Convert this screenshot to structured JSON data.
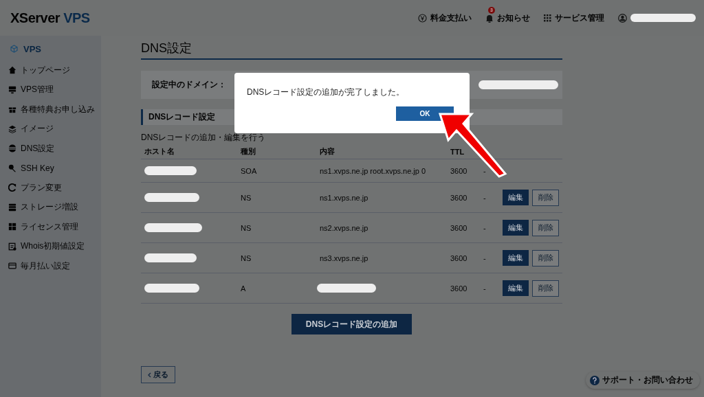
{
  "header": {
    "logo": {
      "brand": "XServer",
      "product": "VPS"
    },
    "nav": [
      {
        "kind": "payment",
        "label": "料金支払い"
      },
      {
        "kind": "notice",
        "label": "お知らせ",
        "badge": "3"
      },
      {
        "kind": "services",
        "label": "サービス管理"
      },
      {
        "kind": "account"
      }
    ]
  },
  "sidebar": {
    "section": "VPS",
    "items": [
      {
        "label": "トップページ"
      },
      {
        "label": "VPS管理"
      },
      {
        "label": "各種特典お申し込み"
      },
      {
        "label": "イメージ"
      },
      {
        "label": "DNS設定"
      },
      {
        "label": "SSH Key"
      },
      {
        "label": "プラン変更"
      },
      {
        "label": "ストレージ増設"
      },
      {
        "label": "ライセンス管理"
      },
      {
        "label": "Whois初期値設定"
      },
      {
        "label": "毎月払い設定"
      }
    ]
  },
  "page": {
    "title": "DNS設定",
    "domain_label": "設定中のドメイン：",
    "section_title": "DNSレコード設定",
    "description": "DNSレコードの追加・編集を行う",
    "columns": [
      "ホスト名",
      "種別",
      "内容",
      "TTL"
    ],
    "rows": [
      {
        "type": "SOA",
        "content": "ns1.xvps.ne.jp root.xvps.ne.jp 0",
        "ttl": "3600",
        "priority": "-"
      },
      {
        "type": "NS",
        "content": "ns1.xvps.ne.jp",
        "ttl": "3600",
        "priority": "-",
        "edit": "編集",
        "delete": "削除"
      },
      {
        "type": "NS",
        "content": "ns2.xvps.ne.jp",
        "ttl": "3600",
        "priority": "-",
        "edit": "編集",
        "delete": "削除"
      },
      {
        "type": "NS",
        "content": "ns3.xvps.ne.jp",
        "ttl": "3600",
        "priority": "-",
        "edit": "編集",
        "delete": "削除"
      },
      {
        "type": "A",
        "ttl": "3600",
        "priority": "-",
        "edit": "編集",
        "delete": "削除"
      }
    ],
    "add_button": "DNSレコード設定の追加",
    "back_button": "戻る"
  },
  "support": "サポート・お問い合わせ",
  "dialog": {
    "message": "DNSレコード設定の追加が完了しました。",
    "button": "OK"
  }
}
